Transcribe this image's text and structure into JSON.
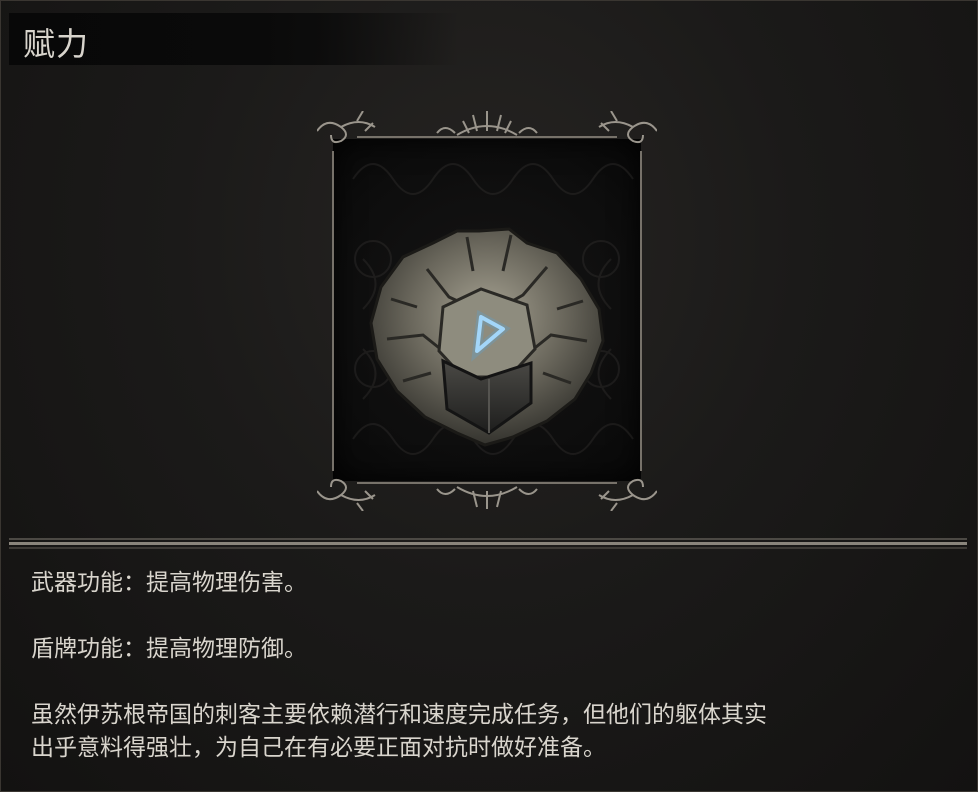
{
  "item": {
    "title": "赋力",
    "icon": "stone-heart-shield-rune-icon",
    "accent_rune_color": "#9fd8ff"
  },
  "description": {
    "weapon_effect": "武器功能：提高物理伤害。",
    "shield_effect": "盾牌功能：提高物理防御。",
    "lore_line1": "虽然伊苏根帝国的刺客主要依赖潜行和速度完成任务，但他们的躯体其实",
    "lore_line2": "出乎意料得强壮，为自己在有必要正面对抗时做好准备。"
  }
}
